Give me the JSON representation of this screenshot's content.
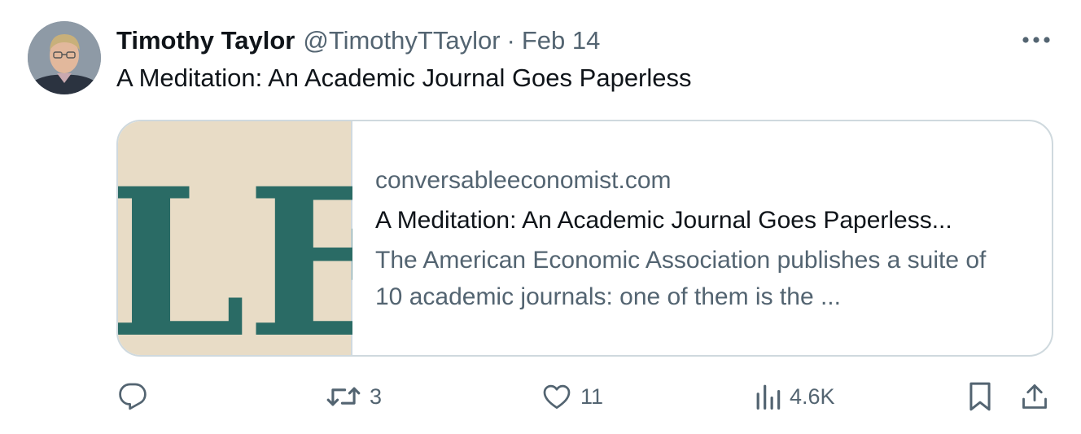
{
  "author": {
    "name": "Timothy Taylor",
    "handle": "@TimothyTTaylor",
    "separator": "·",
    "date": "Feb 14"
  },
  "tweet": {
    "text": "A Meditation: An Academic Journal Goes Paperless"
  },
  "card": {
    "domain": "conversableeconomist.com",
    "title": "A Meditation: An Academic Journal Goes Paperless...",
    "description": "The American Economic Association publishes a suite of 10 academic journals: one of them is the ...",
    "image_letters": "LE",
    "colors": {
      "image_bg": "#e8dcc6",
      "letter": "#2a6b65"
    }
  },
  "actions": {
    "reply": {
      "icon": "reply-icon",
      "count": ""
    },
    "retweet": {
      "icon": "retweet-icon",
      "count": "3"
    },
    "like": {
      "icon": "heart-icon",
      "count": "11"
    },
    "views": {
      "icon": "views-icon",
      "count": "4.6K"
    },
    "bookmark": {
      "icon": "bookmark-icon"
    },
    "share": {
      "icon": "share-icon"
    }
  },
  "colors": {
    "text": "#0f1419",
    "secondary": "#536471",
    "border": "#cfd9de"
  }
}
